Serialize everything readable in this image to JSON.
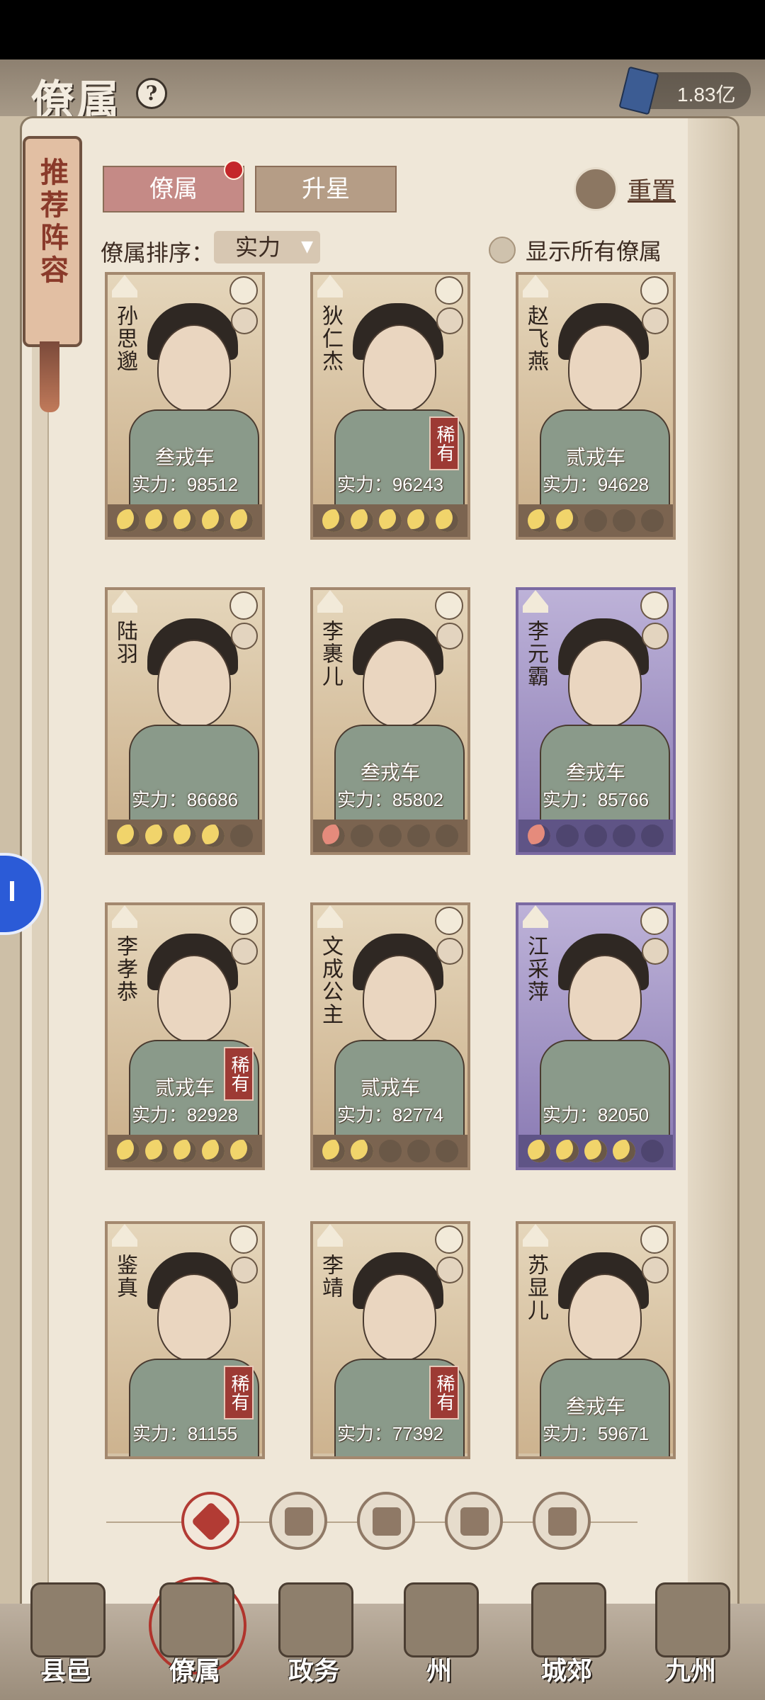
{
  "header": {
    "title": "僚属",
    "help_label": "?",
    "currency": "1.83亿"
  },
  "recommend_banner": "推荐阵容",
  "tabs": [
    {
      "label": "僚属",
      "active": true
    },
    {
      "label": "升星",
      "active": false
    }
  ],
  "reset_label": "重置",
  "sort": {
    "label": "僚属排序：",
    "value": "实力"
  },
  "show_all_label": "显示所有僚属",
  "cards": [
    {
      "name": "孙思邈",
      "rank": "叁戎车",
      "power": "实力：98512",
      "stars": [
        1,
        1,
        1,
        1,
        1
      ],
      "rare": "",
      "purple": false
    },
    {
      "name": "狄仁杰",
      "rank": "",
      "power": "实力：96243",
      "stars": [
        1,
        1,
        1,
        1,
        1
      ],
      "rare": "稀有",
      "purple": false
    },
    {
      "name": "赵飞燕",
      "rank": "贰戎车",
      "power": "实力：94628",
      "stars": [
        1,
        1,
        0,
        0,
        0
      ],
      "rare": "",
      "purple": false
    },
    {
      "name": "陆羽",
      "rank": "",
      "power": "实力：86686",
      "stars": [
        1,
        1,
        1,
        1,
        0
      ],
      "rare": "",
      "purple": false
    },
    {
      "name": "李裹儿",
      "rank": "叁戎车",
      "power": "实力：85802",
      "stars": [
        2,
        0,
        0,
        0,
        0
      ],
      "rare": "",
      "purple": false
    },
    {
      "name": "李元霸",
      "rank": "叁戎车",
      "power": "实力：85766",
      "stars": [
        2,
        0,
        0,
        0,
        0
      ],
      "rare": "",
      "purple": true
    },
    {
      "name": "李孝恭",
      "rank": "贰戎车",
      "power": "实力：82928",
      "stars": [
        1,
        1,
        1,
        1,
        1
      ],
      "rare": "稀有",
      "purple": false
    },
    {
      "name": "文成公主",
      "rank": "贰戎车",
      "power": "实力：82774",
      "stars": [
        1,
        1,
        0,
        0,
        0
      ],
      "rare": "",
      "purple": false
    },
    {
      "name": "江采萍",
      "rank": "",
      "power": "实力：82050",
      "stars": [
        1,
        1,
        1,
        1,
        0
      ],
      "rare": "",
      "purple": true
    },
    {
      "name": "鉴真",
      "rank": "",
      "power": "实力：81155",
      "stars": [],
      "rare": "稀有",
      "purple": false
    },
    {
      "name": "李靖",
      "rank": "",
      "power": "实力：77392",
      "stars": [],
      "rare": "稀有",
      "purple": false
    },
    {
      "name": "苏显儿",
      "rank": "叁戎车",
      "power": "实力：59671",
      "stars": [],
      "rare": "",
      "purple": false
    }
  ],
  "filter_icons": [
    "all-filter-icon",
    "helmet-filter-icon",
    "scroll-filter-icon",
    "fan-filter-icon",
    "craft-filter-icon"
  ],
  "bottom_nav": [
    {
      "label": "县邑",
      "active": false
    },
    {
      "label": "僚属",
      "active": true
    },
    {
      "label": "政务",
      "active": false
    },
    {
      "label": "州",
      "active": false
    },
    {
      "label": "城郊",
      "active": false
    },
    {
      "label": "九州",
      "active": false
    }
  ],
  "colors": {
    "accent_red": "#b23b34",
    "paper": "#efe7d8",
    "rare_badge": "#9d3a34",
    "purple_frame": "#7b6aa2"
  }
}
